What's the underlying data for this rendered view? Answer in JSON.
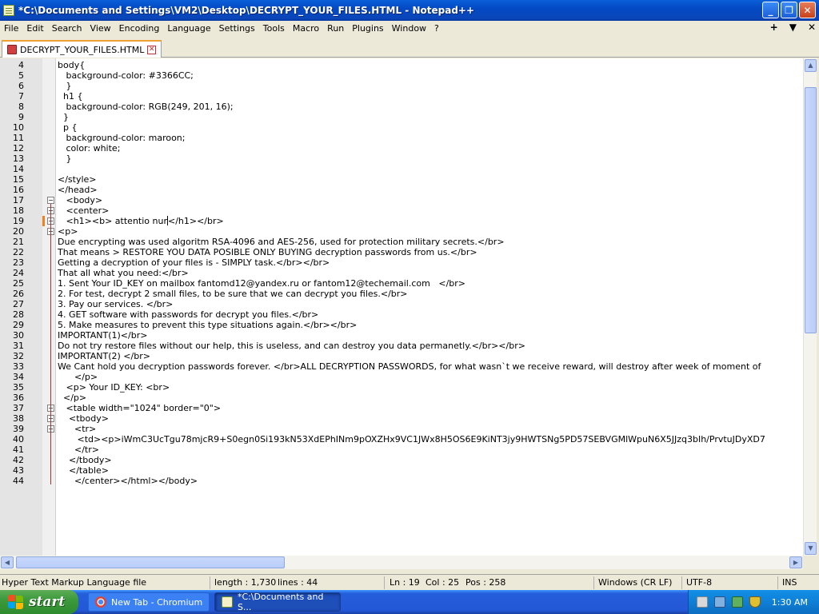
{
  "window": {
    "title": "*C:\\Documents and Settings\\VM2\\Desktop\\DECRYPT_YOUR_FILES.HTML - Notepad++",
    "minimize": "_",
    "restore": "❐",
    "close": "✕"
  },
  "menu": {
    "items": [
      "File",
      "Edit",
      "Search",
      "View",
      "Encoding",
      "Language",
      "Settings",
      "Tools",
      "Macro",
      "Run",
      "Plugins",
      "Window",
      "?"
    ],
    "right": [
      "+",
      "▼",
      "✕"
    ]
  },
  "tab": {
    "label": "DECRYPT_YOUR_FILES.HTML",
    "close": "✕"
  },
  "editor": {
    "current_line": 19,
    "lines": [
      {
        "n": "4",
        "text": "body{"
      },
      {
        "n": "5",
        "text": "   background-color: #3366CC;"
      },
      {
        "n": "6",
        "text": "   }"
      },
      {
        "n": "7",
        "text": "  h1 {"
      },
      {
        "n": "8",
        "text": "   background-color: RGB(249, 201, 16);"
      },
      {
        "n": "9",
        "text": "  }"
      },
      {
        "n": "10",
        "text": "  p {"
      },
      {
        "n": "11",
        "text": "   background-color: maroon;"
      },
      {
        "n": "12",
        "text": "   color: white;"
      },
      {
        "n": "13",
        "text": "   }"
      },
      {
        "n": "14",
        "text": ""
      },
      {
        "n": "15",
        "text": "</style>"
      },
      {
        "n": "16",
        "text": "</head>"
      },
      {
        "n": "17",
        "text": "   <body>"
      },
      {
        "n": "18",
        "text": "   <center>"
      },
      {
        "n": "19",
        "text": "   <h1><b> attentio nur",
        "after_caret": "</h1></br>"
      },
      {
        "n": "20",
        "text": "<p>"
      },
      {
        "n": "21",
        "text": "Due encrypting was used algoritm RSA-4096 and AES-256, used for protection military secrets.</br>"
      },
      {
        "n": "22",
        "text": "That means > RESTORE YOU DATA POSIBLE ONLY BUYING decryption passwords from us.</br>"
      },
      {
        "n": "23",
        "text": "Getting a decryption of your files is - SIMPLY task.</br></br>"
      },
      {
        "n": "24",
        "text": "That all what you need:</br>"
      },
      {
        "n": "25",
        "text": "1. Sent Your ID_KEY on mailbox fantomd12@yandex.ru or fantom12@techemail.com   </br>"
      },
      {
        "n": "26",
        "text": "2. For test, decrypt 2 small files, to be sure that we can decrypt you files.</br>"
      },
      {
        "n": "27",
        "text": "3. Pay our services. </br>"
      },
      {
        "n": "28",
        "text": "4. GET software with passwords for decrypt you files.</br>"
      },
      {
        "n": "29",
        "text": "5. Make measures to prevent this type situations again.</br></br>"
      },
      {
        "n": "30",
        "text": "IMPORTANT(1)</br>"
      },
      {
        "n": "31",
        "text": "Do not try restore files without our help, this is useless, and can destroy you data permanetly.</br></br>"
      },
      {
        "n": "32",
        "text": "IMPORTANT(2) </br>"
      },
      {
        "n": "33",
        "text": "We Cant hold you decryption passwords forever. </br>ALL DECRYPTION PASSWORDS, for what wasn`t we receive reward, will destroy after week of moment of"
      },
      {
        "n": "34",
        "text": "      </p>"
      },
      {
        "n": "35",
        "text": "   <p> Your ID_KEY: <br>"
      },
      {
        "n": "36",
        "text": "  </p>"
      },
      {
        "n": "37",
        "text": "   <table width=\"1024\" border=\"0\">"
      },
      {
        "n": "38",
        "text": "    <tbody>"
      },
      {
        "n": "39",
        "text": "      <tr>"
      },
      {
        "n": "40",
        "text": "       <td><p>iWmC3UcTgu78mjcR9+S0egn0Si193kN53XdEPhINm9pOXZHx9VC1JWx8H5OS6E9KiNT3jy9HWTSNg5PD57SEBVGMlWpuN6X5JJzq3bIh/PrvtuJDyXD7"
      },
      {
        "n": "41",
        "text": "      </tr>"
      },
      {
        "n": "42",
        "text": "    </tbody>"
      },
      {
        "n": "43",
        "text": "    </table>"
      },
      {
        "n": "44",
        "text": "      </center></html></body>"
      }
    ]
  },
  "status": {
    "filetype": "Hyper Text Markup Language file",
    "length": "length : 1,730",
    "lines": "lines : 44",
    "ln": "Ln : 19",
    "col": "Col : 25",
    "pos": "Pos : 258",
    "eol": "Windows (CR LF)",
    "encoding": "UTF-8",
    "mode": "INS"
  },
  "taskbar": {
    "start": "start",
    "tasks": [
      "New Tab - Chromium",
      "*C:\\Documents and S..."
    ],
    "clock": "1:30 AM"
  },
  "colors": {
    "titlebar": "#0349c4",
    "start_button": "#3c9a3c",
    "tab_accent": "#f0a030",
    "fold_line": "#b03030"
  },
  "icons": [
    "notepadpp-icon",
    "minimize-icon",
    "restore-icon",
    "close-icon",
    "document-icon",
    "tab-close-icon",
    "fold-icon",
    "windows-flag-icon",
    "chromium-icon",
    "notepad-icon",
    "tray-icons"
  ]
}
